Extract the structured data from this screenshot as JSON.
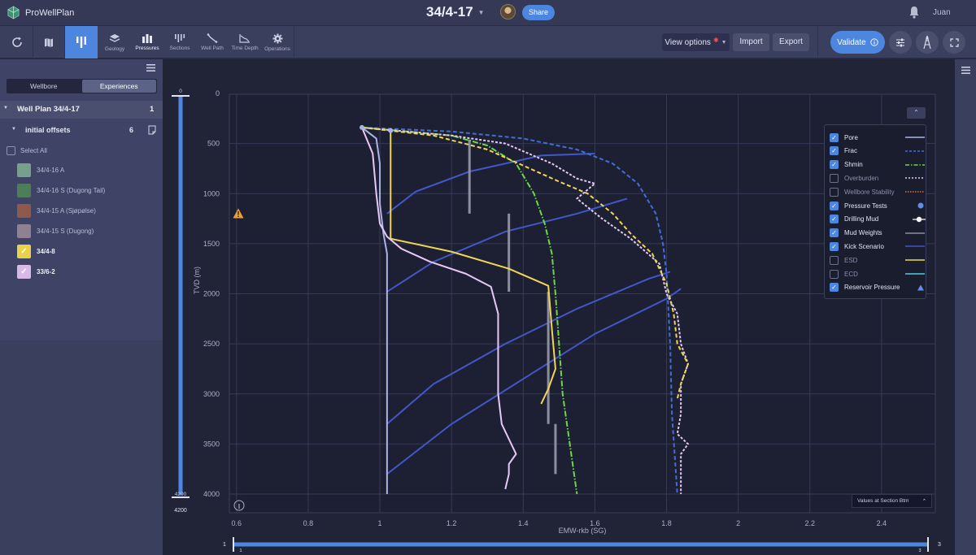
{
  "app": {
    "name": "ProWellPlan"
  },
  "header": {
    "title": "34/4-17",
    "share_label": "Share",
    "user": "Juan"
  },
  "toolbar": {
    "items": [
      {
        "label": "Geology"
      },
      {
        "label": "Pressures"
      },
      {
        "label": "Sections"
      },
      {
        "label": "Well Path"
      },
      {
        "label": "Time Depth"
      },
      {
        "label": "Operations"
      }
    ],
    "view_options": "View options",
    "import": "Import",
    "export": "Export",
    "validate": "Validate"
  },
  "sidebar": {
    "tabs": [
      "Wellbore",
      "Experiences"
    ],
    "well_plan": {
      "label": "Well Plan 34/4-17",
      "count": "1"
    },
    "group": {
      "label": "initial offsets",
      "count": "6"
    },
    "select_all": "Select All",
    "offsets": [
      {
        "label": "34/4-16 A",
        "color": "#7a9e8c",
        "checked": false
      },
      {
        "label": "34/4-16 S (Dugong Tail)",
        "color": "#4e7d5a",
        "checked": false
      },
      {
        "label": "34/4-15 A (Sjøpølse)",
        "color": "#8e5a4c",
        "checked": false
      },
      {
        "label": "34/4-15 S (Dugong)",
        "color": "#8f8092",
        "checked": false
      },
      {
        "label": "34/4-8",
        "color": "#e8d24a",
        "checked": true
      },
      {
        "label": "33/6-2",
        "color": "#d9b9e8",
        "checked": true
      }
    ]
  },
  "legend": {
    "items": [
      {
        "label": "Pore",
        "checked": true
      },
      {
        "label": "Frac",
        "checked": true
      },
      {
        "label": "Shmin",
        "checked": true
      },
      {
        "label": "Overburden",
        "checked": false
      },
      {
        "label": "Wellbore Stability",
        "checked": false
      },
      {
        "label": "Pressure Tests",
        "checked": true
      },
      {
        "label": "Drilling Mud",
        "checked": true
      },
      {
        "label": "Mud Weights",
        "checked": true
      },
      {
        "label": "Kick Scenario",
        "checked": true
      },
      {
        "label": "ESD",
        "checked": false
      },
      {
        "label": "ECD",
        "checked": false
      },
      {
        "label": "Reservoir Pressure",
        "checked": true
      }
    ],
    "values_button": "Values at Section Btm"
  },
  "depth_slider": {
    "top": "0",
    "bottom_handle": "4200",
    "bottom_label": "4200"
  },
  "x_slider": {
    "min": "1",
    "max": "3",
    "min_small": "1",
    "max_small": "3"
  },
  "chart_data": {
    "type": "line",
    "xlabel": "EMW-rkb (SG)",
    "ylabel": "TVD (m)",
    "xlim": [
      0.58,
      2.55
    ],
    "ylim": [
      4200,
      0
    ],
    "x_ticks": [
      "0.6",
      "0.8",
      "1",
      "1.2",
      "1.4",
      "1.6",
      "1.8",
      "2",
      "2.2",
      "2.4"
    ],
    "y_ticks": [
      "0",
      "500",
      "1000",
      "1500",
      "2000",
      "2500",
      "3000",
      "3500",
      "4000"
    ],
    "grid": true,
    "series": [
      {
        "name": "Pore",
        "color": "#aab4e8",
        "dash": "",
        "points": [
          [
            0.95,
            340
          ],
          [
            0.99,
            450
          ],
          [
            1.0,
            700
          ],
          [
            1.0,
            1100
          ],
          [
            1.01,
            1400
          ],
          [
            1.02,
            1600
          ],
          [
            1.02,
            2000
          ],
          [
            1.02,
            3000
          ],
          [
            1.02,
            3500
          ],
          [
            1.02,
            4000
          ]
        ]
      },
      {
        "name": "Frac",
        "color": "#3f6fd6",
        "dash": "5,3",
        "points": [
          [
            0.95,
            340
          ],
          [
            1.2,
            380
          ],
          [
            1.4,
            450
          ],
          [
            1.55,
            560
          ],
          [
            1.65,
            700
          ],
          [
            1.72,
            900
          ],
          [
            1.77,
            1200
          ],
          [
            1.79,
            1500
          ],
          [
            1.8,
            1800
          ],
          [
            1.81,
            2500
          ],
          [
            1.815,
            3200
          ],
          [
            1.83,
            4000
          ]
        ]
      },
      {
        "name": "Shmin",
        "color": "#6fd64a",
        "dash": "7,2,1.5,2",
        "points": [
          [
            0.95,
            340
          ],
          [
            1.2,
            420
          ],
          [
            1.3,
            520
          ],
          [
            1.38,
            700
          ],
          [
            1.43,
            1000
          ],
          [
            1.46,
            1300
          ],
          [
            1.48,
            1600
          ],
          [
            1.49,
            2000
          ],
          [
            1.5,
            2500
          ],
          [
            1.51,
            3000
          ],
          [
            1.53,
            3500
          ],
          [
            1.55,
            4000
          ]
        ]
      },
      {
        "name": "Overburden",
        "color": "#e6c8f2",
        "dash": "3,2",
        "points": [
          [
            0.95,
            340
          ],
          [
            1.2,
            420
          ],
          [
            1.35,
            500
          ],
          [
            1.48,
            700
          ],
          [
            1.55,
            850
          ],
          [
            1.6,
            900
          ],
          [
            1.55,
            1050
          ],
          [
            1.62,
            1250
          ],
          [
            1.7,
            1450
          ],
          [
            1.78,
            1700
          ],
          [
            1.8,
            2000
          ],
          [
            1.83,
            2200
          ],
          [
            1.84,
            2500
          ],
          [
            1.86,
            2700
          ],
          [
            1.84,
            2900
          ],
          [
            1.84,
            3200
          ],
          [
            1.83,
            3400
          ],
          [
            1.86,
            3500
          ],
          [
            1.84,
            3600
          ],
          [
            1.84,
            4000
          ]
        ]
      },
      {
        "name": "Wellbore Stability",
        "color": "#f0d654",
        "dash": "5,3",
        "points": [
          [
            0.95,
            340
          ],
          [
            1.15,
            420
          ],
          [
            1.3,
            560
          ],
          [
            1.4,
            720
          ],
          [
            1.5,
            880
          ],
          [
            1.58,
            1000
          ],
          [
            1.65,
            1200
          ],
          [
            1.7,
            1400
          ],
          [
            1.76,
            1600
          ],
          [
            1.8,
            1900
          ],
          [
            1.82,
            2200
          ],
          [
            1.83,
            2500
          ],
          [
            1.86,
            2700
          ],
          [
            1.84,
            2900
          ],
          [
            1.83,
            3050
          ]
        ]
      },
      {
        "name": "34/4-8",
        "color": "#f0d654",
        "dash": "",
        "points": [
          [
            1.03,
            370
          ],
          [
            1.03,
            1450
          ],
          [
            1.2,
            1580
          ],
          [
            1.36,
            1750
          ],
          [
            1.47,
            1920
          ],
          [
            1.48,
            2350
          ],
          [
            1.49,
            2750
          ],
          [
            1.47,
            2950
          ],
          [
            1.45,
            3100
          ]
        ]
      },
      {
        "name": "33/6-2",
        "color": "#e8c8f5",
        "dash": "",
        "points": [
          [
            0.95,
            340
          ],
          [
            0.98,
            600
          ],
          [
            0.99,
            1000
          ],
          [
            1.0,
            1300
          ],
          [
            1.02,
            1430
          ],
          [
            1.06,
            1550
          ],
          [
            1.14,
            1680
          ],
          [
            1.24,
            1800
          ],
          [
            1.31,
            1930
          ],
          [
            1.33,
            2200
          ],
          [
            1.33,
            2500
          ],
          [
            1.33,
            3000
          ],
          [
            1.34,
            3300
          ],
          [
            1.36,
            3450
          ],
          [
            1.38,
            3600
          ],
          [
            1.36,
            3700
          ],
          [
            1.36,
            3800
          ],
          [
            1.35,
            3950
          ]
        ]
      }
    ],
    "kick_scenarios": [
      {
        "points": [
          [
            1.02,
            1200
          ],
          [
            1.1,
            980
          ],
          [
            1.25,
            780
          ],
          [
            1.45,
            620
          ],
          [
            1.6,
            600
          ]
        ]
      },
      {
        "points": [
          [
            1.02,
            1980
          ],
          [
            1.15,
            1680
          ],
          [
            1.35,
            1380
          ],
          [
            1.55,
            1200
          ],
          [
            1.69,
            1050
          ]
        ]
      },
      {
        "points": [
          [
            1.02,
            3300
          ],
          [
            1.15,
            2900
          ],
          [
            1.35,
            2500
          ],
          [
            1.55,
            2150
          ],
          [
            1.75,
            1850
          ],
          [
            1.81,
            1780
          ]
        ]
      },
      {
        "points": [
          [
            1.02,
            3800
          ],
          [
            1.2,
            3300
          ],
          [
            1.4,
            2850
          ],
          [
            1.6,
            2400
          ],
          [
            1.8,
            2050
          ],
          [
            1.84,
            1950
          ]
        ]
      }
    ],
    "mud_weights": [
      {
        "x": 1.25,
        "top": 460,
        "bottom": 1200
      },
      {
        "x": 1.36,
        "top": 1200,
        "bottom": 1980
      },
      {
        "x": 1.47,
        "top": 1980,
        "bottom": 3300
      },
      {
        "x": 1.49,
        "top": 3300,
        "bottom": 3800
      }
    ],
    "pressure_tests": [
      {
        "x": 0.95,
        "y": 340
      },
      {
        "x": 1.03,
        "y": 370
      }
    ]
  }
}
